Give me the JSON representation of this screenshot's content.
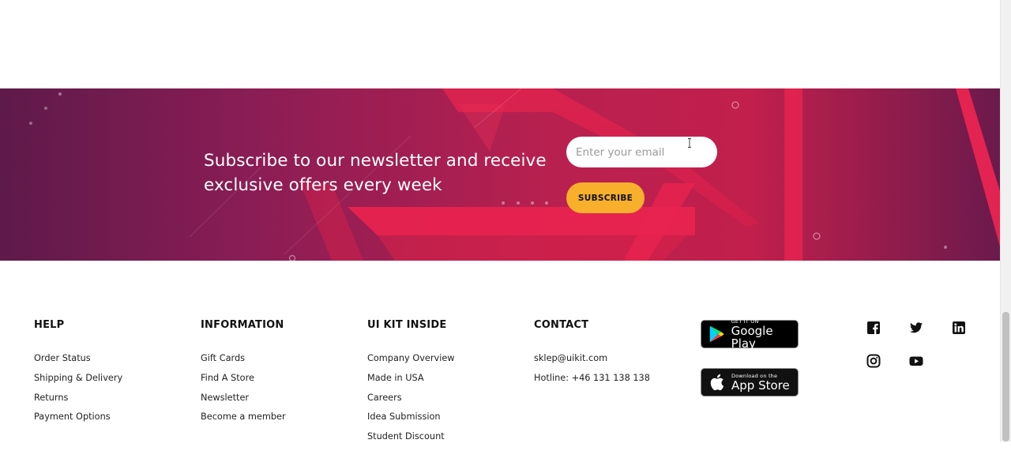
{
  "newsletter": {
    "heading_line1": "Subscribe to our newsletter and receive",
    "heading_line2": "exclusive offers every week",
    "email_placeholder": "Enter your email",
    "subscribe_label": "SUBSCRIBE"
  },
  "footer": {
    "help": {
      "title": "HELP",
      "items": [
        "Order Status",
        "Shipping & Delivery",
        "Returns",
        "Payment Options"
      ]
    },
    "information": {
      "title": "INFORMATION",
      "items": [
        "Gift Cards",
        "Find A Store",
        "Newsletter",
        "Become a member"
      ]
    },
    "uikit": {
      "title": "UI KIT INSIDE",
      "items": [
        "Company Overview",
        "Made in USA",
        "Careers",
        "Idea Submission",
        "Student Discount"
      ]
    },
    "contact": {
      "title": "CONTACT",
      "items": [
        "sklep@uikit.com",
        "Hotline: +46 131 138 138"
      ]
    },
    "apps": {
      "google_small": "GET IT ON",
      "google_big": "Google Play",
      "apple_small": "Download on the",
      "apple_big": "App Store"
    },
    "social_icons": [
      "facebook-icon",
      "twitter-icon",
      "linkedin-icon",
      "instagram-icon",
      "youtube-icon"
    ]
  },
  "colors": {
    "accent_button": "#f8b02c",
    "banner_primary": "#c21f4c",
    "banner_dark": "#5e1a4a"
  }
}
